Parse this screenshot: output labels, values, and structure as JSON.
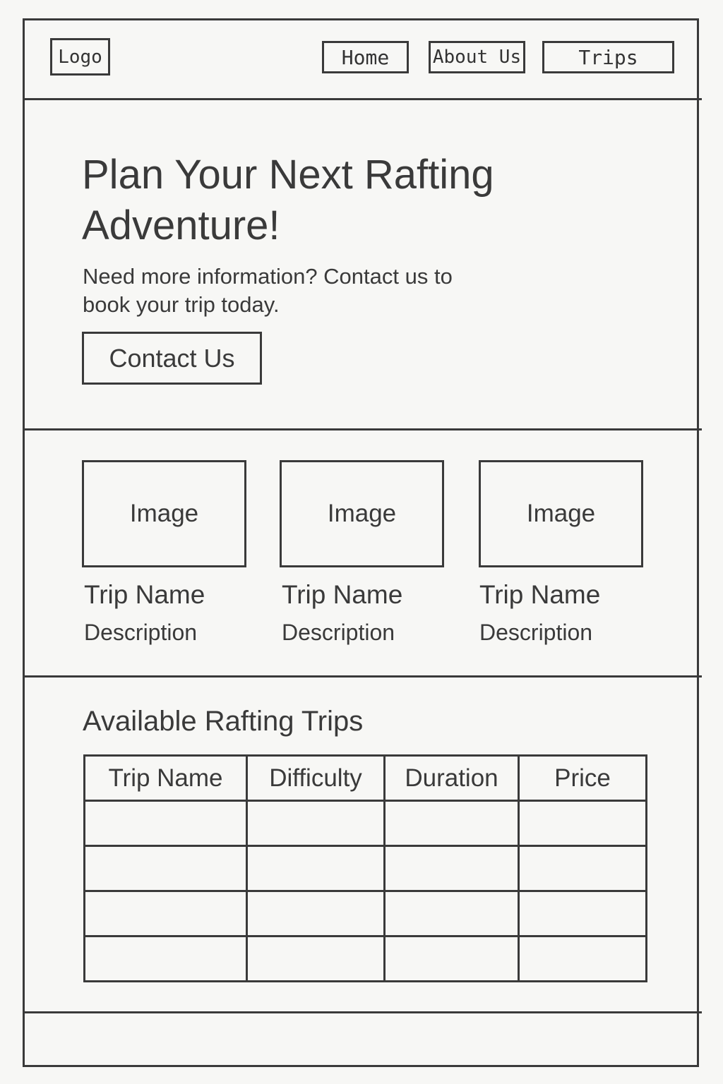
{
  "header": {
    "logo": "Logo",
    "nav": {
      "home": "Home",
      "about": "About Us",
      "trips": "Trips"
    }
  },
  "hero": {
    "title": "Plan Your Next Rafting Adventure!",
    "subtitle": "Need more information? Contact us to book your trip today.",
    "cta": "Contact Us"
  },
  "cards": [
    {
      "image": "Image",
      "name": "Trip Name",
      "description": "Description"
    },
    {
      "image": "Image",
      "name": "Trip Name",
      "description": "Description"
    },
    {
      "image": "Image",
      "name": "Trip Name",
      "description": "Description"
    }
  ],
  "trips_table": {
    "heading": "Available Rafting Trips",
    "columns": [
      "Trip Name",
      "Difficulty",
      "Duration",
      "Price"
    ],
    "rows": [
      [
        "",
        "",
        "",
        ""
      ],
      [
        "",
        "",
        "",
        ""
      ],
      [
        "",
        "",
        "",
        ""
      ],
      [
        "",
        "",
        "",
        ""
      ]
    ]
  }
}
